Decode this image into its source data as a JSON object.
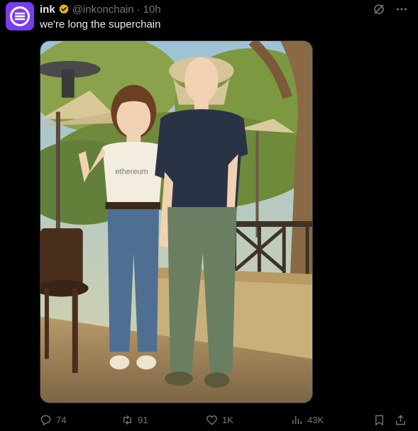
{
  "post": {
    "author_name": "ink",
    "handle": "@inkonchain",
    "separator": "·",
    "time": "10h",
    "text": "we're long the superchain",
    "image_text": "ethereum"
  },
  "actions": {
    "replies": "74",
    "reposts": "91",
    "likes": "1K",
    "views": "43K"
  },
  "colors": {
    "avatar_bg": "#7a3cf0",
    "verified_badge": "#e6b422",
    "muted": "#71767b"
  },
  "icons": [
    "ink-logo-icon",
    "verified-badge-icon",
    "grok-icon",
    "more-icon",
    "reply-icon",
    "repost-icon",
    "like-icon",
    "views-icon",
    "bookmark-icon",
    "share-icon"
  ]
}
